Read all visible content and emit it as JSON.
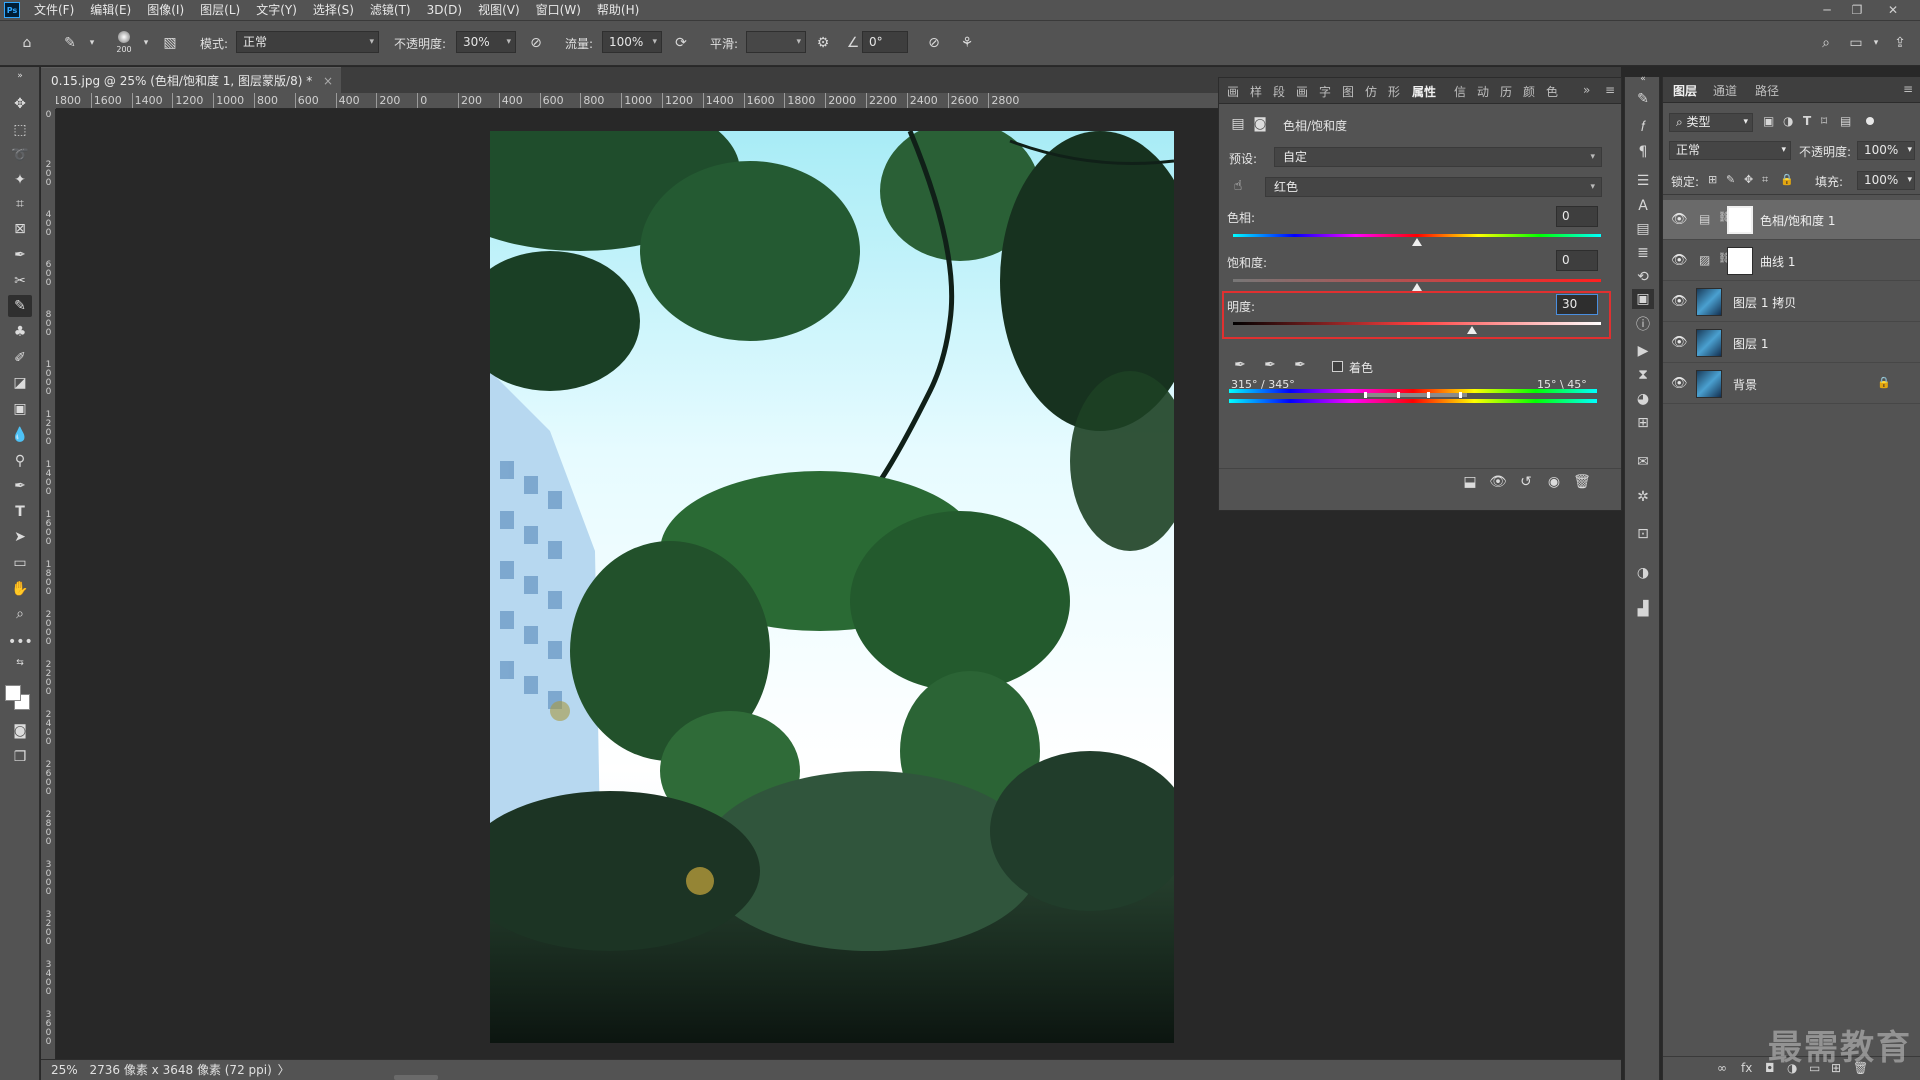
{
  "menubar": {
    "logo": "Ps",
    "items": [
      "文件(F)",
      "编辑(E)",
      "图像(I)",
      "图层(L)",
      "文字(Y)",
      "选择(S)",
      "滤镜(T)",
      "3D(D)",
      "视图(V)",
      "窗口(W)",
      "帮助(H)"
    ],
    "minimize": "─",
    "restore": "❐",
    "close": "✕"
  },
  "options": {
    "brush_size": "200",
    "mode_label": "模式:",
    "mode_value": "正常",
    "opacity_label": "不透明度:",
    "opacity_value": "30%",
    "flow_label": "流量:",
    "flow_value": "100%",
    "smooth_label": "平滑:",
    "smooth_value": "",
    "angle_value": "0°"
  },
  "document": {
    "tab_title": "0.15.jpg @ 25% (色相/饱和度 1, 图层蒙版/8) *",
    "close": "×",
    "zoom": "25%",
    "info": "2736 像素 x 3648 像素 (72 ppi)",
    "info_arrow": "〉"
  },
  "ruler": {
    "h_labels": [
      "1800",
      "1600",
      "1400",
      "1200",
      "1000",
      "800",
      "600",
      "400",
      "200",
      "0",
      "200",
      "400",
      "600",
      "800",
      "1000",
      "1200",
      "1400",
      "1600",
      "1800",
      "2000",
      "2200",
      "2400",
      "2600",
      "2800"
    ],
    "v_labels": [
      "0",
      "2 0 0",
      "4 0 0",
      "6 0 0",
      "8 0 0",
      "1 0 0 0",
      "1 2 0 0",
      "1 4 0 0",
      "1 6 0 0",
      "1 8 0 0",
      "2 0 0 0",
      "2 2 0 0",
      "2 4 0 0",
      "2 6 0 0",
      "2 8 0 0",
      "3 0 0 0",
      "3 2 0 0",
      "3 4 0 0",
      "3 6 0 0"
    ]
  },
  "properties": {
    "tab_icons": [
      "画",
      "样",
      "段",
      "画",
      "字",
      "图",
      "仿",
      "形"
    ],
    "active_tab": "属性",
    "right_tabs": [
      "信",
      "动",
      "历",
      "颜",
      "色"
    ],
    "expand": "»",
    "menu": "≡",
    "header_title": "色相/饱和度",
    "preset_label": "预设:",
    "preset_value": "自定",
    "channel_value": "红色",
    "hue_label": "色相:",
    "hue_value": "0",
    "hue_level": 0,
    "saturation_label": "饱和度:",
    "saturation_value": "0",
    "saturation_level": 0,
    "lightness_label": "明度:",
    "lightness_value": "30",
    "lightness_level": 30,
    "colorize_label": "着色",
    "range_left": "315° / 345°",
    "range_right": "15° \\ 45°"
  },
  "layers": {
    "tabs": [
      "图层",
      "通道",
      "路径"
    ],
    "filter_value": "类型",
    "blend_value": "正常",
    "opacity_label": "不透明度:",
    "opacity_value": "100%",
    "lock_label": "锁定:",
    "fill_label": "填充:",
    "fill_value": "100%",
    "items": [
      {
        "name": "色相/饱和度 1"
      },
      {
        "name": "曲线 1"
      },
      {
        "name": "图层 1 拷贝"
      },
      {
        "name": "图层 1"
      },
      {
        "name": "背景"
      }
    ],
    "footer_icons": [
      "∞",
      "fx",
      "◘",
      "◑",
      "▭",
      "⊞",
      "🗑"
    ]
  },
  "watermark": "最需教育",
  "colors": {
    "accent_red": "#e03030",
    "panel": "#535353",
    "dark": "#282828"
  }
}
